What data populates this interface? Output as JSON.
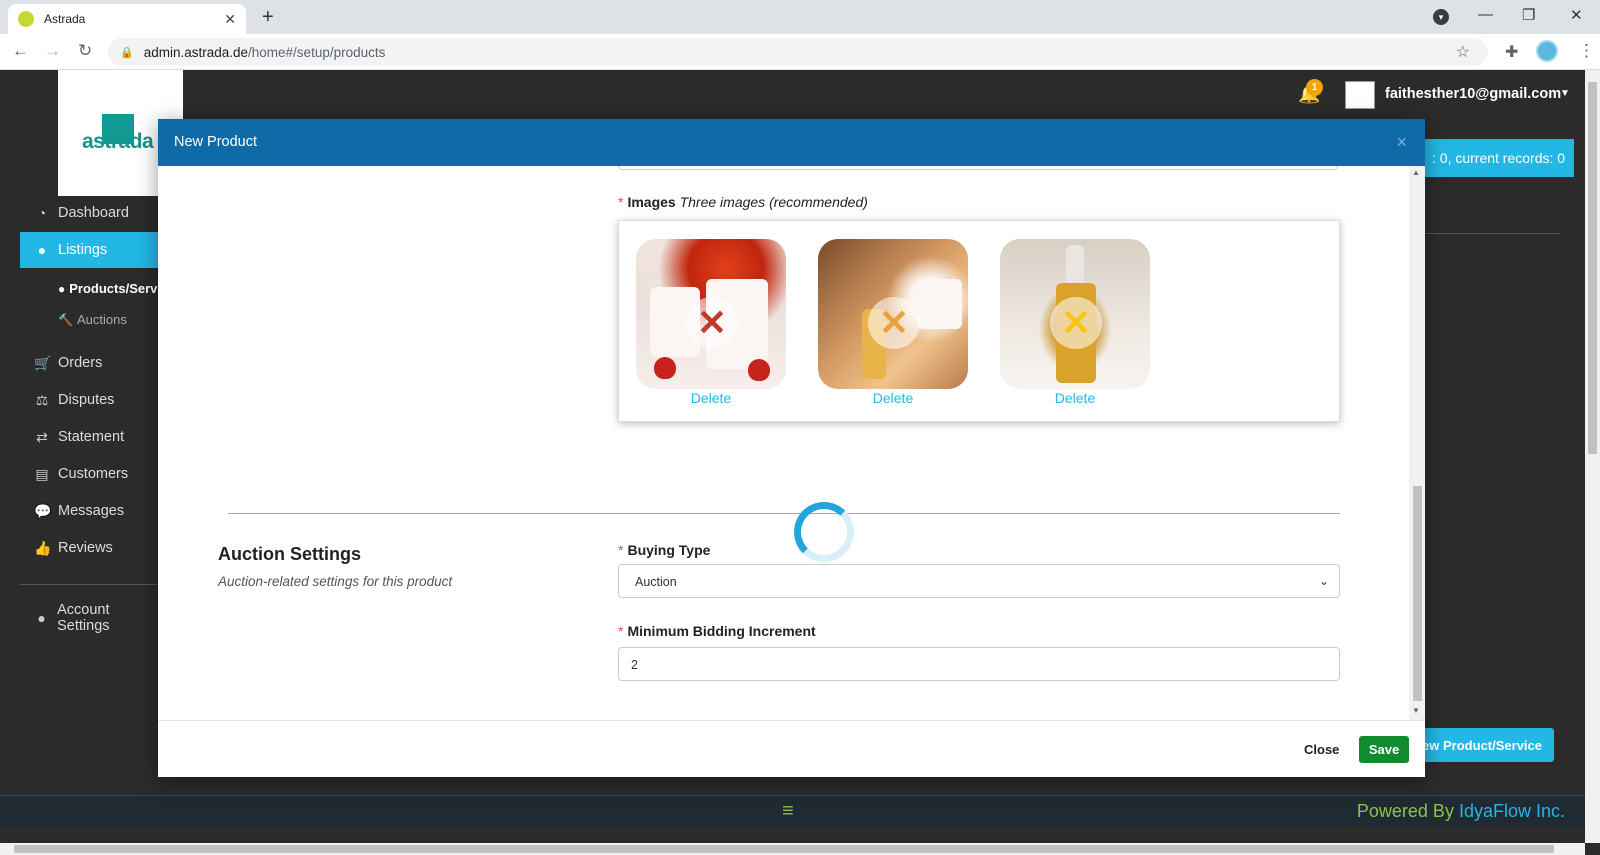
{
  "browser": {
    "tab_title": "Astrada",
    "tab_close": "✕",
    "new_tab": "+",
    "url_domain": "admin.astrada.de",
    "url_path": "/home#/setup/products",
    "window_controls": [
      "—",
      "❐",
      "✕"
    ]
  },
  "app": {
    "logo_text": "astrada",
    "notification_count": "1",
    "user_email": "faithesther10@gmail.com",
    "records_text": ": 0, current records: 0",
    "new_product_button": "New Product/Service",
    "footer_menu": "≡",
    "footer_powered": "Powered By ",
    "footer_brand": "IdyaFlow Inc."
  },
  "sidebar": {
    "items": [
      {
        "label": "Dashboard",
        "icon": "dashboard-icon",
        "glyph": "◔"
      },
      {
        "label": "Listings",
        "icon": "listings-icon",
        "glyph": "●"
      },
      {
        "label": "Orders",
        "icon": "cart-icon",
        "glyph": "🛒"
      },
      {
        "label": "Disputes",
        "icon": "scale-icon",
        "glyph": "⚖"
      },
      {
        "label": "Statement",
        "icon": "exchange-icon",
        "glyph": "⇄"
      },
      {
        "label": "Customers",
        "icon": "address-book-icon",
        "glyph": "▤"
      },
      {
        "label": "Messages",
        "icon": "comments-icon",
        "glyph": "💬"
      },
      {
        "label": "Reviews",
        "icon": "thumbs-up-icon",
        "glyph": "👍"
      },
      {
        "label": "Account Settings",
        "icon": "user-circle-icon",
        "glyph": "●"
      }
    ],
    "sub_items": [
      {
        "label": "Products/Serv",
        "icon": "product-icon",
        "glyph": "●"
      },
      {
        "label": "Auctions",
        "icon": "gavel-icon",
        "glyph": "🔨"
      }
    ]
  },
  "modal": {
    "title": "New Product",
    "close_x": "×",
    "images_label": "Images",
    "images_hint": "Three images (recommended)",
    "images": [
      {
        "delete_label": "Delete",
        "overlay_color": "#c0392b"
      },
      {
        "delete_label": "Delete",
        "overlay_color": "#e6a23c"
      },
      {
        "delete_label": "Delete",
        "overlay_color": "#f5c518"
      }
    ],
    "section_title": "Auction Settings",
    "section_subtitle": "Auction-related settings for this product",
    "buying_type_label": "Buying Type",
    "buying_type_value": "Auction",
    "min_increment_label": "Minimum Bidding Increment",
    "min_increment_value": "2",
    "close_button": "Close",
    "save_button": "Save"
  },
  "colors": {
    "accent": "#23b7e5",
    "modal_header": "#0e6ba8",
    "save": "#128a2e",
    "footer_text": "#8bc34a"
  }
}
